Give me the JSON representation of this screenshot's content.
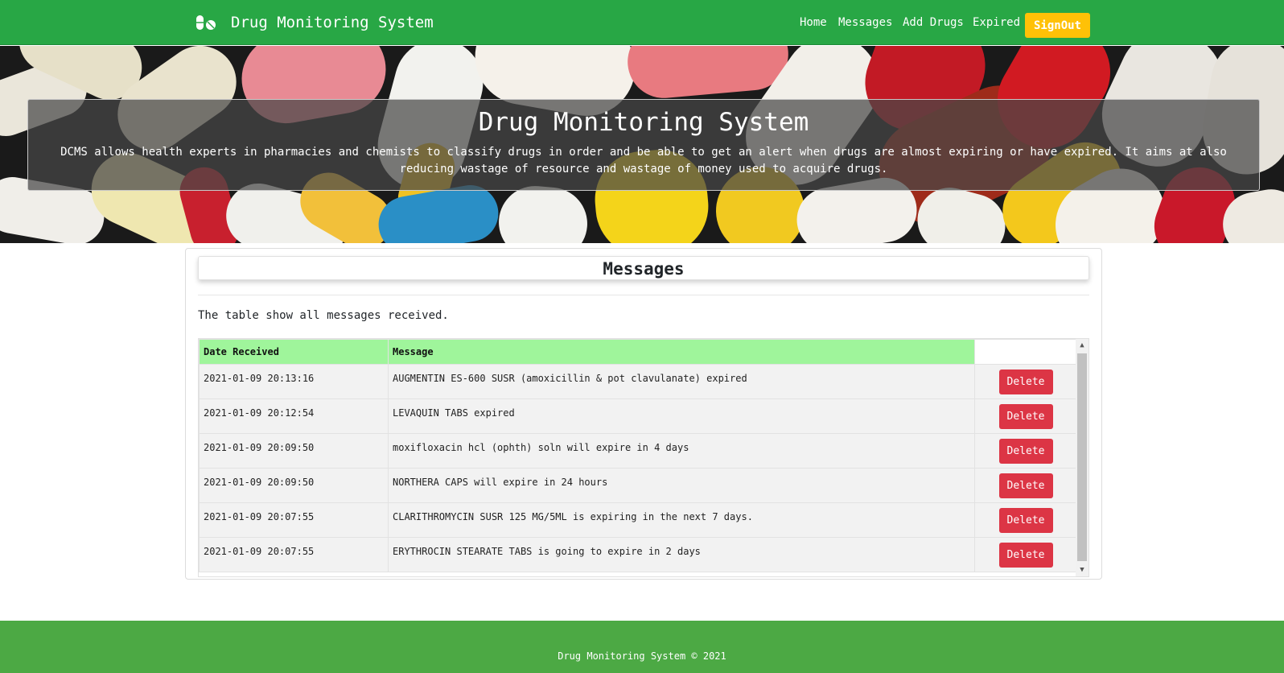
{
  "colors": {
    "navbar": "#28a745",
    "signout": "#ffc107",
    "delete": "#dc3545",
    "table_header": "#9ff59b",
    "footer": "#4ca944"
  },
  "navbar": {
    "brand_icon": "pills-icon",
    "brand": "Drug Monitoring System",
    "links": [
      "Home",
      "Messages",
      "Add Drugs",
      "Expired"
    ],
    "signout_label": "SignOut"
  },
  "hero": {
    "title": "Drug Monitoring System",
    "description": "DCMS allows health experts in pharmacies and chemists to classify drugs in order and be able to get an alert when drugs are almost expiring or have expired. It aims at also reducing wastage of resource and wastage of money used to acquire drugs."
  },
  "main": {
    "title": "Messages",
    "description": "The table show all messages received.",
    "table": {
      "columns": [
        "Date Received",
        "Message",
        ""
      ],
      "rows": [
        {
          "date": "2021-01-09 20:13:16",
          "message": "AUGMENTIN ES-600 SUSR (amoxicillin & pot clavulanate) expired",
          "action": "Delete"
        },
        {
          "date": "2021-01-09 20:12:54",
          "message": "LEVAQUIN TABS expired",
          "action": "Delete"
        },
        {
          "date": "2021-01-09 20:09:50",
          "message": "moxifloxacin hcl (ophth) soln will expire in 4 days",
          "action": "Delete"
        },
        {
          "date": "2021-01-09 20:09:50",
          "message": "NORTHERA CAPS will expire in 24 hours",
          "action": "Delete"
        },
        {
          "date": "2021-01-09 20:07:55",
          "message": "CLARITHROMYCIN SUSR 125 MG/5ML is expiring in the next 7 days.",
          "action": "Delete"
        },
        {
          "date": "2021-01-09 20:07:55",
          "message": "ERYTHROCIN STEARATE TABS is going to expire in 2 days",
          "action": "Delete"
        }
      ]
    }
  },
  "footer": {
    "text": "Drug Monitoring System © 2021"
  }
}
